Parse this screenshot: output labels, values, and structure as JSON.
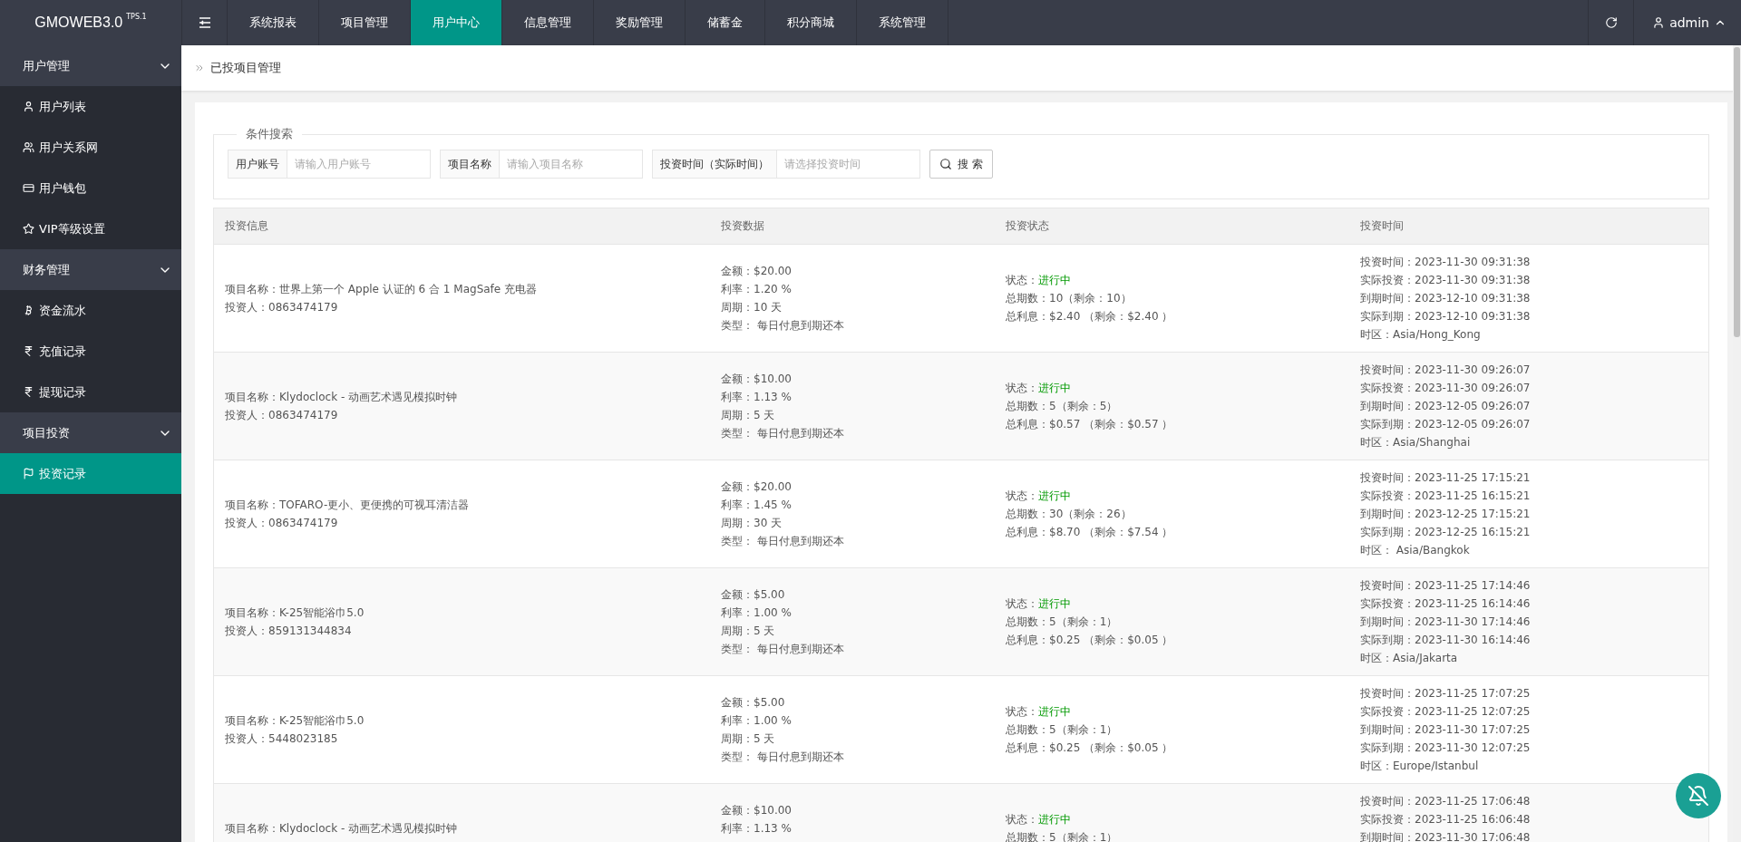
{
  "logo": {
    "name": "GMOWEB3.0",
    "version": "TPS.1"
  },
  "top_nav": [
    {
      "label": "系统报表",
      "selected": false
    },
    {
      "label": "项目管理",
      "selected": false
    },
    {
      "label": "用户中心",
      "selected": true
    },
    {
      "label": "信息管理",
      "selected": false
    },
    {
      "label": "奖励管理",
      "selected": false
    },
    {
      "label": "储蓄金",
      "selected": false
    },
    {
      "label": "积分商城",
      "selected": false
    },
    {
      "label": "系统管理",
      "selected": false
    }
  ],
  "user": {
    "name": "admin"
  },
  "sidebar": [
    {
      "label": "用户管理",
      "expanded": true,
      "children": [
        {
          "label": "用户列表",
          "kind": "user",
          "selected": false
        },
        {
          "label": "用户关系网",
          "kind": "users",
          "selected": false
        },
        {
          "label": "用户钱包",
          "kind": "card",
          "selected": false
        },
        {
          "label": "VIP等级设置",
          "kind": "star",
          "selected": false
        }
      ]
    },
    {
      "label": "财务管理",
      "expanded": true,
      "children": [
        {
          "label": "资金流水",
          "kind": "bitcoin",
          "selected": false
        },
        {
          "label": "充值记录",
          "kind": "rupee",
          "selected": false
        },
        {
          "label": "提现记录",
          "kind": "rupee",
          "selected": false
        }
      ]
    },
    {
      "label": "项目投资",
      "expanded": true,
      "children": [
        {
          "label": "投资记录",
          "kind": "flag",
          "selected": true
        }
      ]
    }
  ],
  "breadcrumb": "已投项目管理",
  "search": {
    "legend": "条件搜索",
    "fields": [
      {
        "label": "用户账号",
        "placeholder": "请输入用户账号"
      },
      {
        "label": "项目名称",
        "placeholder": "请输入项目名称"
      },
      {
        "label": "投资时间（实际时间）",
        "placeholder": "请选择投资时间"
      }
    ],
    "button": "搜 索"
  },
  "table": {
    "columns": [
      "投资信息",
      "投资数据",
      "投资状态",
      "投资时间"
    ],
    "rows": [
      {
        "info": [
          "项目名称：世界上第一个 Apple 认证的 6 合 1 MagSafe 充电器",
          "投资人：0863474179"
        ],
        "data": [
          "金额：$20.00",
          "利率：1.20 %",
          "周期：10 天",
          "类型： 每日付息到期还本"
        ],
        "status": {
          "label": "状态：",
          "value": "进行中",
          "lines": [
            "总期数：10（剩余：10）",
            "总利息：$2.40 （剩余：$2.40 ）"
          ]
        },
        "times": [
          "投资时间：2023-11-30 09:31:38",
          "实际投资：2023-11-30 09:31:38",
          "到期时间：2023-12-10 09:31:38",
          "实际到期：2023-12-10 09:31:38",
          "时区：Asia/Hong_Kong"
        ]
      },
      {
        "info": [
          "项目名称：Klydoclock - 动画艺术遇见模拟时钟",
          "投资人：0863474179"
        ],
        "data": [
          "金额：$10.00",
          "利率：1.13 %",
          "周期：5 天",
          "类型： 每日付息到期还本"
        ],
        "status": {
          "label": "状态：",
          "value": "进行中",
          "lines": [
            "总期数：5（剩余：5）",
            "总利息：$0.57 （剩余：$0.57 ）"
          ]
        },
        "times": [
          "投资时间：2023-11-30 09:26:07",
          "实际投资：2023-11-30 09:26:07",
          "到期时间：2023-12-05 09:26:07",
          "实际到期：2023-12-05 09:26:07",
          "时区：Asia/Shanghai"
        ]
      },
      {
        "info": [
          "项目名称：TOFARO-更小、更便携的可视耳清洁器",
          "投资人：0863474179"
        ],
        "data": [
          "金额：$20.00",
          "利率：1.45 %",
          "周期：30 天",
          "类型： 每日付息到期还本"
        ],
        "status": {
          "label": "状态：",
          "value": "进行中",
          "lines": [
            "总期数：30（剩余：26）",
            "总利息：$8.70 （剩余：$7.54 ）"
          ]
        },
        "times": [
          "投资时间：2023-11-25 17:15:21",
          "实际投资：2023-11-25 16:15:21",
          "到期时间：2023-12-25 17:15:21",
          "实际到期：2023-12-25 16:15:21",
          "时区： Asia/Bangkok"
        ]
      },
      {
        "info": [
          "项目名称：K-25智能浴巾5.0",
          "投资人：859131344834"
        ],
        "data": [
          "金额：$5.00",
          "利率：1.00 %",
          "周期：5 天",
          "类型： 每日付息到期还本"
        ],
        "status": {
          "label": "状态：",
          "value": "进行中",
          "lines": [
            "总期数：5（剩余：1）",
            "总利息：$0.25 （剩余：$0.05 ）"
          ]
        },
        "times": [
          "投资时间：2023-11-25 17:14:46",
          "实际投资：2023-11-25 16:14:46",
          "到期时间：2023-11-30 17:14:46",
          "实际到期：2023-11-30 16:14:46",
          "时区：Asia/Jakarta"
        ]
      },
      {
        "info": [
          "项目名称：K-25智能浴巾5.0",
          "投资人：5448023185"
        ],
        "data": [
          "金额：$5.00",
          "利率：1.00 %",
          "周期：5 天",
          "类型： 每日付息到期还本"
        ],
        "status": {
          "label": "状态：",
          "value": "进行中",
          "lines": [
            "总期数：5（剩余：1）",
            "总利息：$0.25 （剩余：$0.05 ）"
          ]
        },
        "times": [
          "投资时间：2023-11-25 17:07:25",
          "实际投资：2023-11-25 12:07:25",
          "到期时间：2023-11-30 17:07:25",
          "实际到期：2023-11-30 12:07:25",
          "时区：Europe/Istanbul"
        ]
      },
      {
        "info": [
          "项目名称：Klydoclock - 动画艺术遇见模拟时钟"
        ],
        "data": [
          "金额：$10.00",
          "利率：1.13 %"
        ],
        "status": {
          "label": "状态：",
          "value": "进行中",
          "lines": [
            "总期数：5（剩余：1）"
          ]
        },
        "times": [
          "投资时间：2023-11-25 17:06:48",
          "实际投资：2023-11-25 16:06:48",
          "到期时间：2023-11-30 17:06:48"
        ]
      }
    ]
  }
}
